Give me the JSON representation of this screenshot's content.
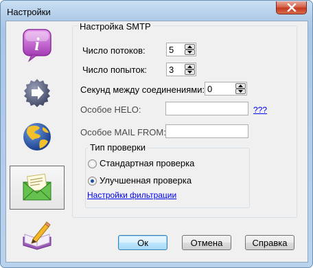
{
  "window": {
    "title": "Настройки"
  },
  "sidebar": {
    "items": [
      {
        "icon": "info-icon",
        "selected": false
      },
      {
        "icon": "arrow-right-icon",
        "selected": false
      },
      {
        "icon": "globe-icon",
        "selected": false
      },
      {
        "icon": "mail-icon",
        "selected": true
      },
      {
        "icon": "book-pencil-icon",
        "selected": false
      }
    ]
  },
  "smtp": {
    "panel_title": "Настройка SMTP",
    "threads_label": "Число потоков:",
    "threads_value": "5",
    "attempts_label": "Число попыток:",
    "attempts_value": "3",
    "delay_label": "Секунд между соединениями:",
    "delay_value": "0",
    "helo_label": "Особое HELO:",
    "helo_value": "",
    "helo_help_link": "???",
    "mailfrom_label": "Особое MAIL FROM:",
    "mailfrom_value": ""
  },
  "check": {
    "group_title": "Тип проверки",
    "options": [
      {
        "label": "Стандартная проверка",
        "checked": false
      },
      {
        "label": "Улучшенная проверка",
        "checked": true
      }
    ],
    "filter_link": "Настройки фильтрации"
  },
  "buttons": {
    "ok": "Ок",
    "cancel": "Отмена",
    "help": "Справка"
  }
}
